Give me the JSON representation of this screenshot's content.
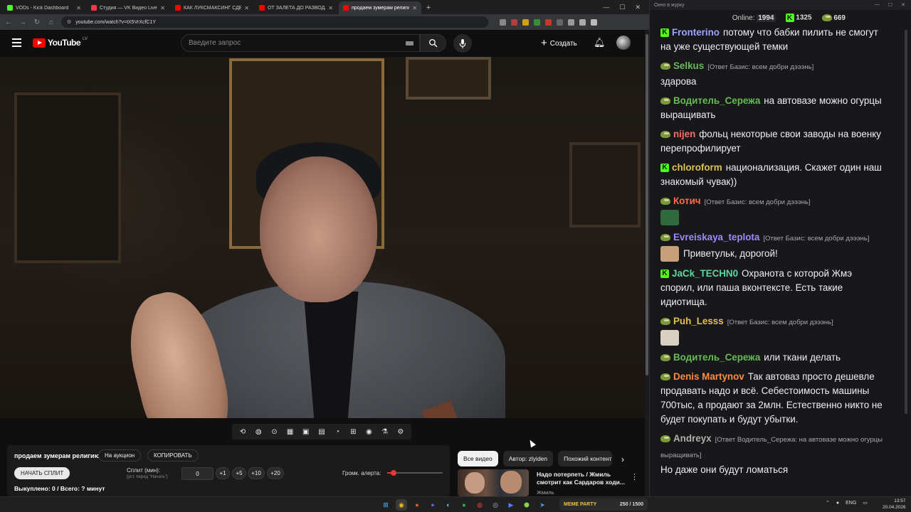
{
  "browser": {
    "tabs": [
      {
        "title": "VODs - Kick Dashboard",
        "favicon_color": "#53fc18"
      },
      {
        "title": "Студия — VK Видео Live",
        "favicon_color": "#ff3347"
      },
      {
        "title": "КАК ЛУКСМАКСИНГ СДЕЛАЛ",
        "favicon_color": "#ff0000"
      },
      {
        "title": "ОТ ЗАЛЕТА ДО РАЗВОДА: по",
        "favicon_color": "#ff0000"
      },
      {
        "title": "продаем зумерам религи",
        "favicon_color": "#ff0000",
        "active": true
      }
    ],
    "url": "youtube.com/watch?v=tX5VrXcfC1Y",
    "window_controls": [
      "—",
      "☐",
      "✕"
    ]
  },
  "youtube": {
    "logo": "YouTube",
    "region": "LV",
    "search_placeholder": "Введите запрос",
    "create_label": "Создать"
  },
  "panel": {
    "title": "продаем зумерам религию",
    "auction_label": "На аукцион",
    "copy_label": "КОПИРОВАТЬ",
    "start_split_label": "НАЧАТЬ СПЛИТ",
    "split_label": "Сплит (мин):",
    "split_hint": "(уст. перед \"Начать\")",
    "split_value": "0",
    "step_buttons": [
      "+1",
      "+5",
      "+10",
      "+20"
    ],
    "volume_label": "Громк. алерта:",
    "volume_level": 0.12,
    "paid_line": "Выкуплено: 0 / Всего: ? минут"
  },
  "chips": [
    "Все видео",
    "Автор: zlyiden",
    "Похожий контент"
  ],
  "recommended": {
    "title": "Надо потерпеть / Жмиль смотрит как Сардаров ходи...",
    "author": "Жмиль"
  },
  "chat": {
    "window_title": "Окно в журку",
    "online_label": "Online:",
    "online_count": "1994",
    "kick_count": "1325",
    "other_count": "669",
    "messages": [
      {
        "user": "Fronterino",
        "color": "#9da4ff",
        "badge": "kick",
        "reply": "",
        "text": "потому что бабки пилить не смогут на уже существующей темки"
      },
      {
        "user": "Selkus",
        "color": "#66bb55",
        "badge": "pepe",
        "reply": "[Ответ Базис: всем добри дэээнь]",
        "text": "здарова"
      },
      {
        "user": "Водитель_Сережа",
        "color": "#66bb55",
        "badge": "pepe",
        "reply": "",
        "text": "на автовазе можно огурцы выращивать"
      },
      {
        "user": "nijen",
        "color": "#ff6b6b",
        "badge": "pepe",
        "reply": "",
        "text": "фольц некоторые свои заводы на военку перепрофилирует"
      },
      {
        "user": "chloroform",
        "color": "#e0c050",
        "badge": "kick",
        "reply": "",
        "text": "национализация. Скажет один наш знакомый чувак))"
      },
      {
        "user": "Котич",
        "color": "#ff6b4b",
        "badge": "pepe",
        "reply": "[Ответ Базис: всем добри дэээнь]",
        "text": "",
        "emote_color": "#2f6a3a"
      },
      {
        "user": "Evreiskaya_teplota",
        "color": "#9a8cff",
        "badge": "pepe",
        "reply": "[Ответ Базис: всем добри дэээнь]",
        "text": "Приветульк, дорогой!",
        "emote_color": "#c7a07a"
      },
      {
        "user": "JaCk_TECHN0",
        "color": "#5ad8a0",
        "badge": "kick",
        "reply": "",
        "text": "Охранота с которой Жмэ спорил, или паша вконтексте. Есть такие идиотища."
      },
      {
        "user": "Puh_Lesss",
        "color": "#e0c050",
        "badge": "pepe",
        "reply": "[Ответ Базис: всем добри дэээнь]",
        "text": "",
        "emote_color": "#d8d0c0"
      },
      {
        "user": "Водитель_Сережа",
        "color": "#66bb55",
        "badge": "pepe",
        "reply": "",
        "text": "или ткани делать"
      },
      {
        "user": "Denis Martynov",
        "color": "#ff8c42",
        "badge": "pepe",
        "reply": "",
        "text": "Так автоваз просто дешевле продавать надо и всё. Себестоимость машины 700тыс, а продают за 2млн. Естественно никто не будет покупать и будут убытки."
      },
      {
        "user": "Andreyx",
        "color": "#b0b0b0",
        "badge": "pepe",
        "reply": "[Ответ Водитель_Сережа: на автовазе можно огурцы выращивать]",
        "text": "Но даже они будут ломаться"
      }
    ]
  },
  "taskbar": {
    "meme_label": "MEME PARTY",
    "meme_progress": "250 / 1500",
    "lang": "ENG",
    "time": "13:57",
    "date": "20.04.2026"
  },
  "colors": {
    "youtube_red": "#ff0000",
    "kick_green": "#53fc18",
    "chat_bg": "#18181b"
  }
}
